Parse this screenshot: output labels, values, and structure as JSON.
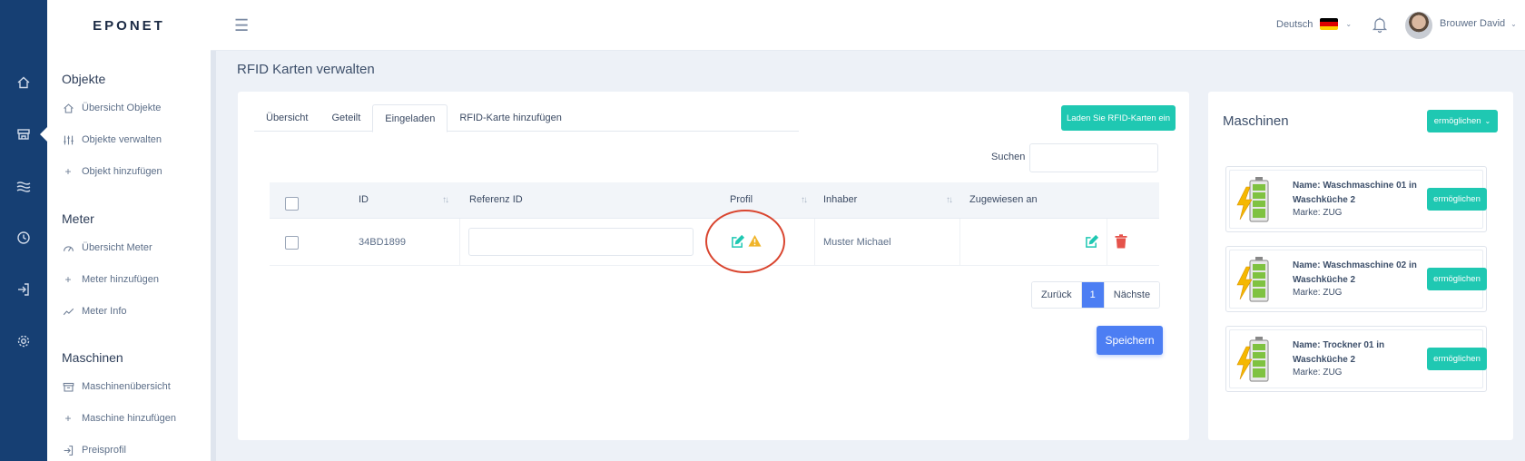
{
  "app": {
    "logo": "EPONET"
  },
  "header": {
    "language": "Deutsch",
    "username": "Brouwer David",
    "flag_colors": [
      "#000000",
      "#dd0000",
      "#ffce00"
    ]
  },
  "sidebar": {
    "sections": [
      {
        "title": "Objekte",
        "items": [
          {
            "label": "Übersicht Objekte",
            "icon": "home-icon"
          },
          {
            "label": "Objekte verwalten",
            "icon": "sliders-icon"
          },
          {
            "label": "Objekt hinzufügen",
            "icon": "plus-icon"
          }
        ]
      },
      {
        "title": "Meter",
        "items": [
          {
            "label": "Übersicht Meter",
            "icon": "gauge-icon"
          },
          {
            "label": "Meter hinzufügen",
            "icon": "plus-icon"
          },
          {
            "label": "Meter Info",
            "icon": "trend-icon"
          }
        ]
      },
      {
        "title": "Maschinen",
        "items": [
          {
            "label": "Maschinenübersicht",
            "icon": "archive-icon"
          },
          {
            "label": "Maschine hinzufügen",
            "icon": "plus-icon"
          },
          {
            "label": "Preisprofil",
            "icon": "login-icon"
          }
        ]
      }
    ]
  },
  "page": {
    "title": "RFID Karten verwalten"
  },
  "tabs": [
    {
      "label": "Übersicht"
    },
    {
      "label": "Geteilt"
    },
    {
      "label": "Eingeladen"
    },
    {
      "label": "RFID-Karte hinzufügen"
    }
  ],
  "load_button": "Laden Sie RFID-Karten ein",
  "search": {
    "label": "Suchen",
    "placeholder": ""
  },
  "table": {
    "headers": {
      "id": "ID",
      "ref": "Referenz ID",
      "profile": "Profil",
      "owner": "Inhaber",
      "assigned": "Zugewiesen an"
    },
    "rows": [
      {
        "id": "34BD1899",
        "ref": "",
        "owner": "Muster Michael",
        "assigned": ""
      }
    ]
  },
  "pagination": {
    "prev": "Zurück",
    "current": "1",
    "next": "Nächste"
  },
  "save_button": "Speichern",
  "machines": {
    "title": "Maschinen",
    "enable_all": "ermöglichen",
    "items": [
      {
        "name": "Name: Waschmaschine 01 in Waschküche 2",
        "brand": "Marke: ZUG",
        "button": "ermöglichen"
      },
      {
        "name": "Name: Waschmaschine 02 in Waschküche 2",
        "brand": "Marke: ZUG",
        "button": "ermöglichen"
      },
      {
        "name": "Name: Trockner 01 in Waschküche 2",
        "brand": "Marke: ZUG",
        "button": "ermöglichen"
      }
    ]
  },
  "colors": {
    "accent": "#1fc8b2",
    "primary": "#4c7ef3",
    "rail": "#163f73",
    "danger": "#e5534b",
    "highlight": "#d9452f"
  }
}
